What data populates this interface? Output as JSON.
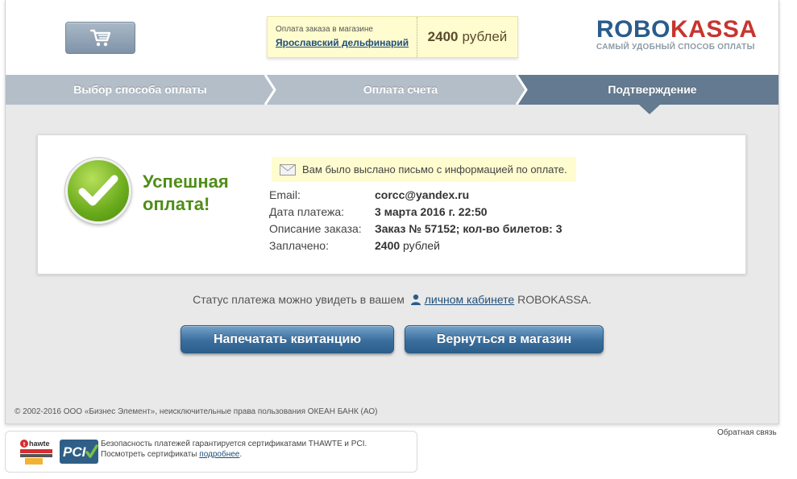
{
  "header": {
    "cart_icon": "shopping-cart-icon",
    "order_caption": "Оплата заказа в магазине",
    "shop_name": "Ярославский дельфинарий",
    "amount": "2400",
    "currency": "рублей",
    "logo_part1": "ROBO",
    "logo_part2": "KASSA",
    "logo_tagline": "САМЫЙ УДОБНЫЙ СПОСОБ ОПЛАТЫ"
  },
  "steps": [
    {
      "label": "Выбор способа оплаты",
      "active": false
    },
    {
      "label": "Оплата счета",
      "active": false
    },
    {
      "label": "Подтверждение",
      "active": true
    }
  ],
  "result": {
    "title_line1": "Успешная",
    "title_line2": "оплата!",
    "email_note": "Вам было выслано письмо с информацией по оплате.",
    "details": [
      {
        "label": "Email:",
        "value": "corcc@yandex.ru"
      },
      {
        "label": "Дата платежа:",
        "value": "3 марта 2016 г. 22:50"
      },
      {
        "label": "Описание заказа:",
        "value": "Заказ № 57152; кол-во билетов: 3"
      },
      {
        "label": "Заплачено:",
        "value": "2400",
        "suffix": "рублей"
      }
    ]
  },
  "status": {
    "prefix": "Статус платежа можно увидеть в вашем",
    "link": "личном кабинете",
    "suffix": "ROBOKASSA."
  },
  "buttons": {
    "print": "Напечатать квитанцию",
    "back": "Вернуться в магазин"
  },
  "footer": {
    "copyright": "© 2002-2016 ООО «Бизнес Элемент», неисключительные права пользования ОКЕАН БАНК (АО)",
    "security_line1": "Безопасность платежей гарантируется сертификатами THAWTE и PCI.",
    "security_line2_prefix": "Посмотреть сертификаты",
    "security_link": "подробнее",
    "security_line2_suffix": ".",
    "feedback": "Обратная связь"
  },
  "colors": {
    "accent_blue": "#2a5c8b",
    "brand_red": "#c8342f",
    "success_green": "#4f8d17",
    "step_gray": "#b4bec9",
    "step_active": "#637a90"
  }
}
